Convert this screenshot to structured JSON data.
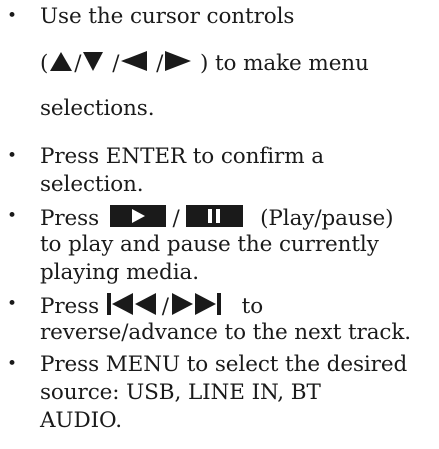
{
  "bullets": [
    {
      "line1": "Use the cursor controls",
      "line2_open": "(",
      "line2_sep": "/",
      "line2_close": ") to make menu",
      "line3": "selections.",
      "icons": [
        "arrow-up-icon",
        "arrow-down-icon",
        "arrow-left-icon",
        "arrow-right-icon"
      ]
    },
    {
      "line1": "Press ENTER to confirm a",
      "line2": "selection."
    },
    {
      "press": "Press",
      "sep": "/",
      "after": "(Play/pause)",
      "line2": "to play and pause the currently",
      "line3": "playing media.",
      "icons": [
        "play-icon",
        "pause-icon"
      ]
    },
    {
      "press": "Press",
      "sep": "/",
      "after": "to",
      "line2": "reverse/advance to the next track.",
      "icons": [
        "rewind-icon",
        "fast-forward-icon"
      ]
    },
    {
      "line1": "Press MENU to select the desired",
      "line2": "source: USB, LINE IN, BT",
      "line3": "AUDIO."
    }
  ],
  "bullet_glyph": "•"
}
